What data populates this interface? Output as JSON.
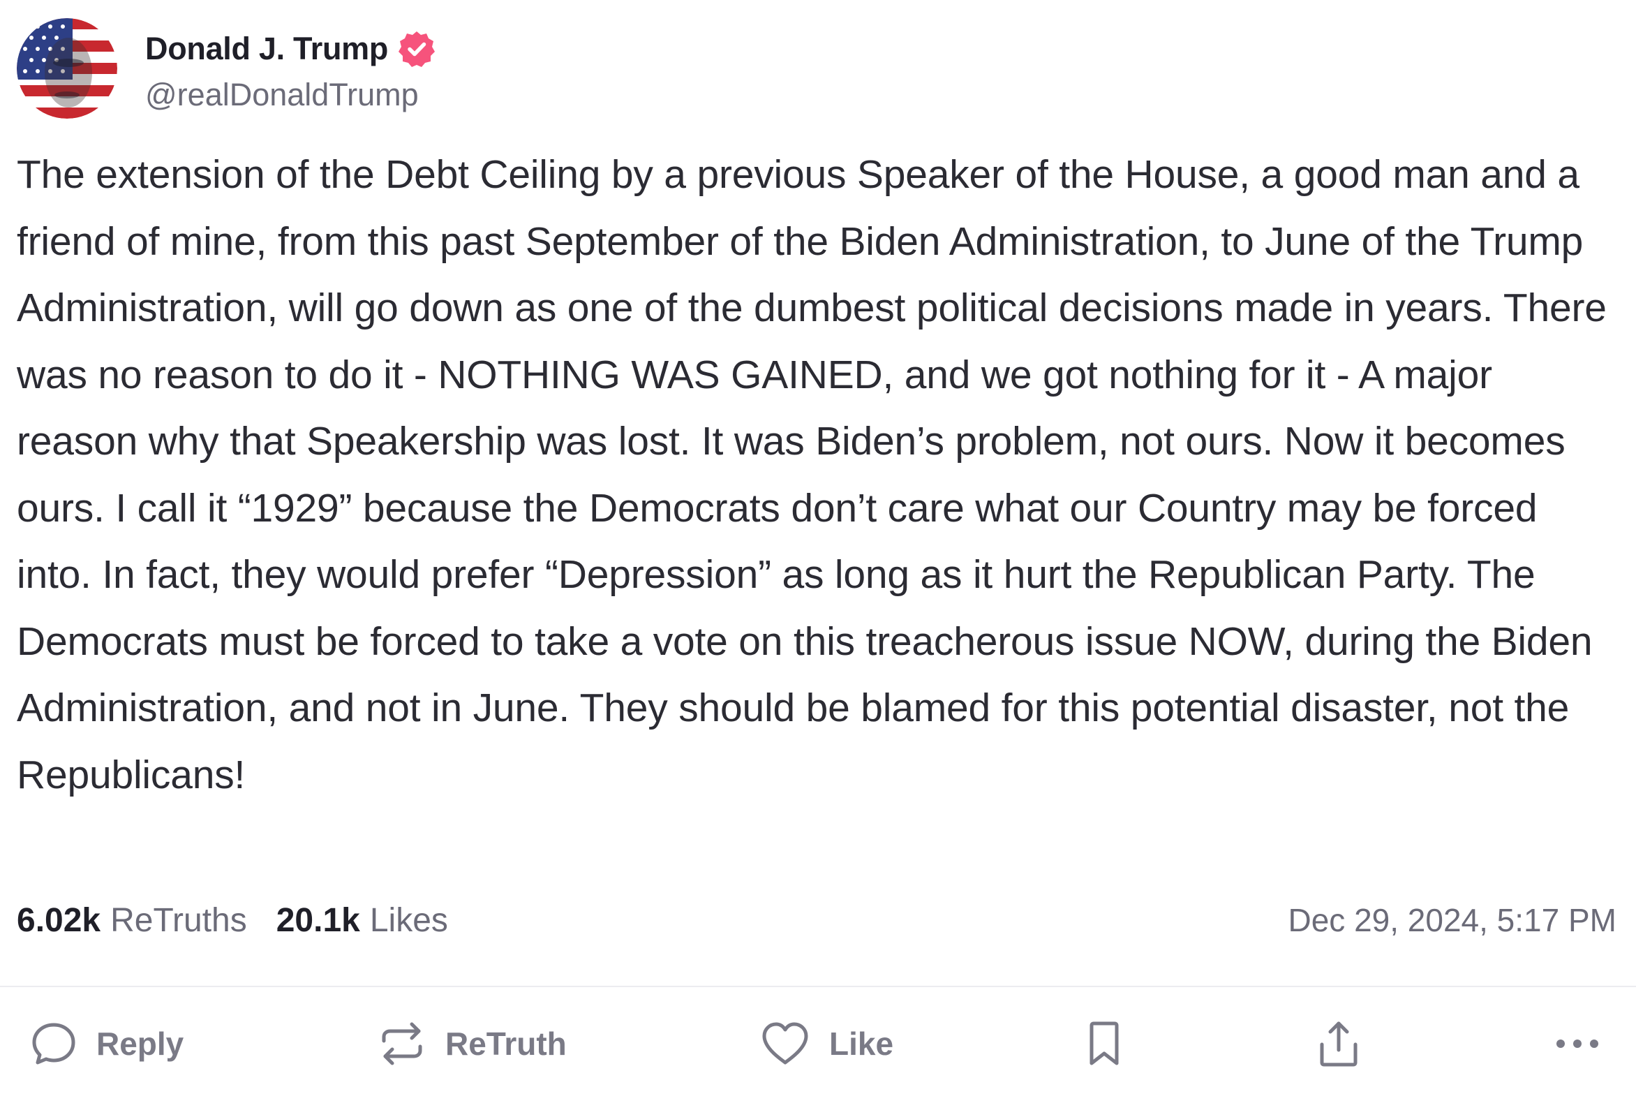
{
  "post": {
    "author": {
      "display_name": "Donald J. Trump",
      "handle": "@realDonaldTrump",
      "verified_icon": "verified-badge-icon",
      "accent_color": "#f6537c"
    },
    "text": "The extension of the Debt Ceiling by a previous Speaker of the House, a good man and a friend of mine, from this past September of the Biden Administration, to June of the Trump Administration, will go down as one of the dumbest political decisions made in years. There was no reason to do it - NOTHING WAS GAINED, and we got nothing for it - A major reason why that Speakership was lost. It was Biden’s problem, not ours. Now it becomes ours. I call it “1929” because the Democrats don’t care what our Country may be forced into. In fact, they would prefer “Depression” as long as it hurt the Republican Party. The Democrats must be forced to take a vote on this treacherous issue NOW, during the Biden Administration, and not in June. They should be blamed for this potential disaster, not the Republicans!",
    "stats": {
      "retruths_count": "6.02k",
      "retruths_label": "ReTruths",
      "likes_count": "20.1k",
      "likes_label": "Likes"
    },
    "timestamp": "Dec 29, 2024, 5:17 PM"
  },
  "actions": {
    "reply": {
      "label": "Reply",
      "icon": "reply-bubble-icon"
    },
    "retruth": {
      "label": "ReTruth",
      "icon": "retruth-arrows-icon"
    },
    "like": {
      "label": "Like",
      "icon": "heart-icon"
    },
    "bookmark": {
      "icon": "bookmark-icon"
    },
    "share": {
      "icon": "share-upload-icon"
    },
    "more": {
      "icon": "more-dots-icon"
    }
  }
}
